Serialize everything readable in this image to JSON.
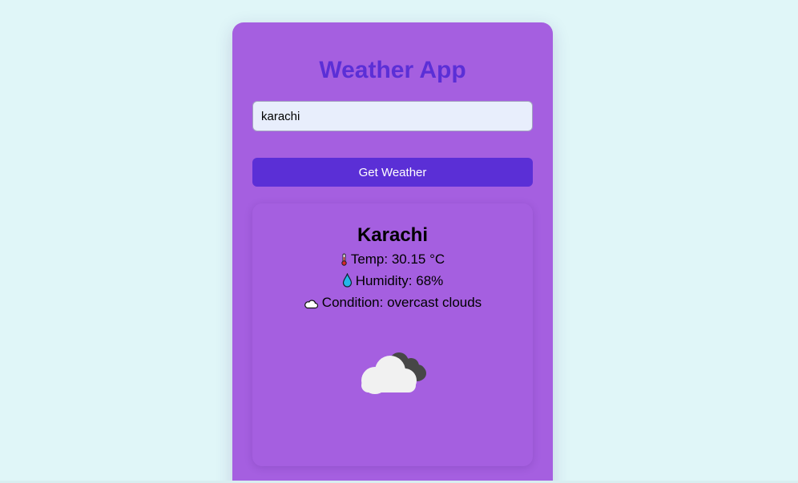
{
  "app": {
    "title": "Weather App"
  },
  "search": {
    "value": "karachi"
  },
  "actions": {
    "get_weather_label": "Get Weather"
  },
  "result": {
    "city": "Karachi",
    "temp_text": "Temp: 30.15 °C",
    "humidity_text": "Humidity: 68%",
    "condition_text": "Condition: overcast clouds",
    "weather_icon": "overcast-clouds-icon"
  },
  "icons": {
    "temp": "thermometer-icon",
    "humidity": "droplet-icon",
    "condition": "cloud-icon"
  },
  "colors": {
    "background": "#e0f6f8",
    "card": "#a55fe0",
    "accent": "#5b2fd6",
    "input_background": "#e8eefc",
    "button_text": "#ffffff"
  }
}
